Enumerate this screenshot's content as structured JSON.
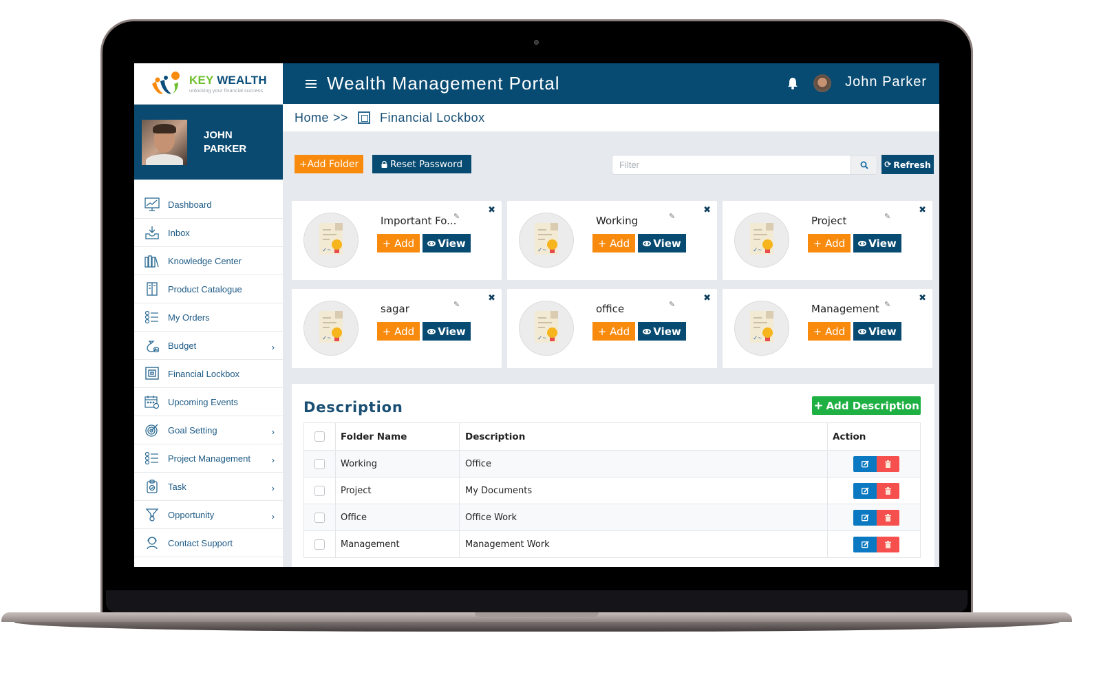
{
  "brand": {
    "name_part1": "KEY",
    "name_part2": "WEALTH",
    "tagline": "unlocking your financial success"
  },
  "profile": {
    "name_line1": "JOHN",
    "name_line2": "PARKER"
  },
  "header": {
    "title": "Wealth Management Portal",
    "user_name": "John Parker"
  },
  "breadcrumb": {
    "home": "Home",
    "separator": ">>",
    "current": "Financial Lockbox"
  },
  "sidebar": {
    "items": [
      {
        "label": "Dashboard",
        "icon": "dashboard-icon",
        "has_submenu": false
      },
      {
        "label": "Inbox",
        "icon": "inbox-icon",
        "has_submenu": false
      },
      {
        "label": "Knowledge Center",
        "icon": "books-icon",
        "has_submenu": false
      },
      {
        "label": "Product Catalogue",
        "icon": "catalogue-icon",
        "has_submenu": false
      },
      {
        "label": "My Orders",
        "icon": "checklist-icon",
        "has_submenu": false
      },
      {
        "label": "Budget",
        "icon": "money-bag-icon",
        "has_submenu": true
      },
      {
        "label": "Financial Lockbox",
        "icon": "safe-icon",
        "has_submenu": false
      },
      {
        "label": "Upcoming Events",
        "icon": "calendar-icon",
        "has_submenu": false
      },
      {
        "label": "Goal Setting",
        "icon": "target-icon",
        "has_submenu": true
      },
      {
        "label": "Project Management",
        "icon": "checklist-icon",
        "has_submenu": true
      },
      {
        "label": "Task",
        "icon": "clipboard-icon",
        "has_submenu": true
      },
      {
        "label": "Opportunity",
        "icon": "funnel-icon",
        "has_submenu": true
      },
      {
        "label": "Contact Support",
        "icon": "headset-icon",
        "has_submenu": false
      }
    ],
    "chevron": "›"
  },
  "toolbar": {
    "add_folder_label": "+Add Folder",
    "reset_password_label": "Reset Password",
    "filter_placeholder": "Filter",
    "refresh_label": "Refresh"
  },
  "folders": [
    {
      "name": "Important Fo...",
      "add_label": "+ Add",
      "view_label": "View"
    },
    {
      "name": "Working",
      "add_label": "+ Add",
      "view_label": "View"
    },
    {
      "name": "Project",
      "add_label": "+ Add",
      "view_label": "View"
    },
    {
      "name": "sagar",
      "add_label": "+ Add",
      "view_label": "View"
    },
    {
      "name": "office",
      "add_label": "+ Add",
      "view_label": "View"
    },
    {
      "name": "Management",
      "add_label": "+ Add",
      "view_label": "View"
    }
  ],
  "description_panel": {
    "title": "Description",
    "add_label": "Add Description",
    "columns": [
      "Folder Name",
      "Description",
      "Action"
    ],
    "rows": [
      {
        "folder": "Working",
        "description": "Office"
      },
      {
        "folder": "Project",
        "description": "My Documents"
      },
      {
        "folder": "Office",
        "description": "Office Work"
      },
      {
        "folder": "Management",
        "description": "Management Work"
      }
    ]
  },
  "colors": {
    "navy": "#074a72",
    "orange": "#f88a0e",
    "green": "#1eb043",
    "edit_blue": "#0b79c1",
    "delete_red": "#f5504d",
    "page_bg": "#e6e9ee"
  }
}
